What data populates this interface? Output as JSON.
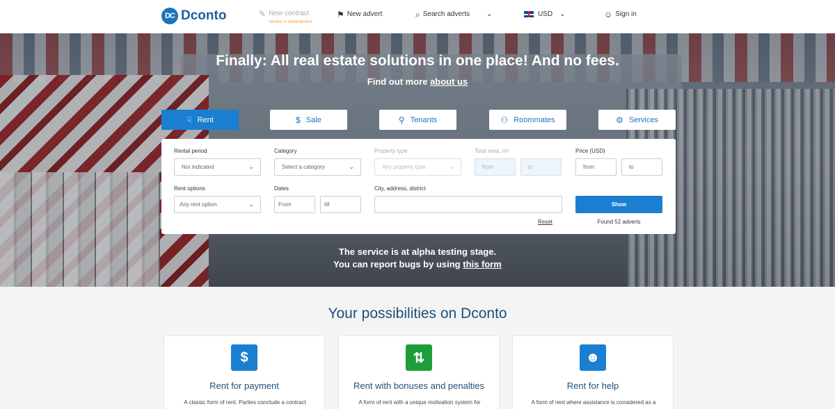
{
  "header": {
    "logo_badge": "DC",
    "logo_text": "Dconto",
    "new_contract": "New contract",
    "new_contract_note": "Section in development",
    "new_advert": "New advert",
    "search_adverts": "Search adverts",
    "currency": "USD",
    "sign_in": "Sign in"
  },
  "hero": {
    "title": "Finally: All real estate solutions in one place! And no fees.",
    "sub_prefix": "Find out more",
    "sub_link": "about us",
    "alpha_line1": "The service is at alpha testing stage.",
    "alpha_line2_prefix": "You can report bugs by using",
    "alpha_link": "this form"
  },
  "tabs": {
    "rent": "Rent",
    "sale": "Sale",
    "tenants": "Tenants",
    "roommates": "Roommates",
    "services": "Services"
  },
  "search": {
    "rental_period_label": "Rental period",
    "rental_period_value": "Not indicated",
    "category_label": "Category",
    "category_value": "Select a category",
    "property_type_label": "Property type",
    "property_type_value": "Any property type",
    "total_area_label": "Total area, m²",
    "area_from": "from",
    "area_to": "to",
    "price_label": "Price (USD)",
    "price_from": "from",
    "price_to": "to",
    "rent_options_label": "Rent options",
    "rent_options_value": "Any rent option",
    "dates_label": "Dates",
    "date_from": "From",
    "date_till": "till",
    "city_label": "City, address, district",
    "city_value": "",
    "show_button": "Show",
    "reset": "Reset",
    "found": "Found 52 adverts"
  },
  "section": {
    "title": "Your possibilities on Dconto",
    "cards": [
      {
        "title": "Rent for payment",
        "text": "A classic form of rent. Parties conclude a contract",
        "icon": "house-dollar-icon",
        "color": "#1a7fd0"
      },
      {
        "title": "Rent with bonuses and penalties",
        "text": "A form of rent with a unique motivation system for",
        "icon": "up-down-arrows-icon",
        "color": "#1e9e3a"
      },
      {
        "title": "Rent for help",
        "text": "A form of rent where assistance is considered as a",
        "icon": "helper-person-icon",
        "color": "#1a7fd0"
      }
    ]
  }
}
